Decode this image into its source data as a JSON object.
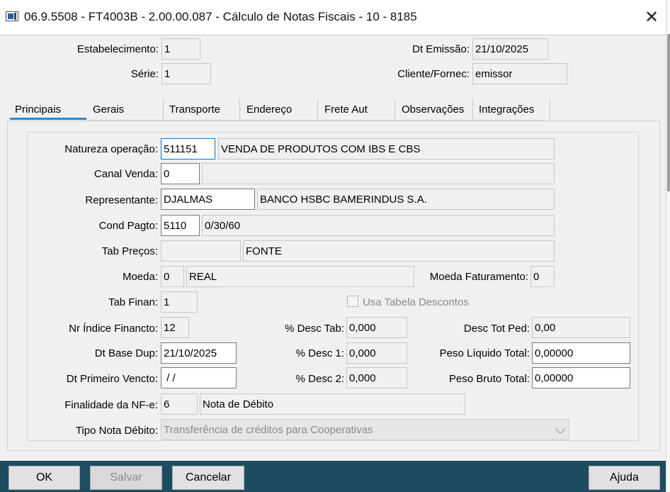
{
  "window": {
    "title": "06.9.5508 - FT4003B - 2.00.00.087 - Cálculo de Notas Fiscais - 10 - 8185",
    "close_icon": "close-icon"
  },
  "header": {
    "estabelecimento_label": "Estabelecimento:",
    "estabelecimento_value": "1",
    "serie_label": "Série:",
    "serie_value": "1",
    "dt_emissao_label": "Dt Emissão:",
    "dt_emissao_value": "21/10/2025",
    "cliente_label": "Cliente/Fornec:",
    "cliente_value": "emissor"
  },
  "tabs": [
    {
      "label": "Principais",
      "active": true
    },
    {
      "label": "Gerais"
    },
    {
      "label": "Transporte"
    },
    {
      "label": "Endereço"
    },
    {
      "label": "Frete Aut"
    },
    {
      "label": "Observações"
    },
    {
      "label": "Integrações"
    }
  ],
  "form": {
    "natureza_label": "Natureza operação:",
    "natureza_code": "511151",
    "natureza_desc": "VENDA DE PRODUTOS COM IBS E CBS",
    "canal_label": "Canal Venda:",
    "canal_code": "0",
    "canal_desc": "",
    "representante_label": "Representante:",
    "representante_code": "DJALMAS",
    "representante_desc": "BANCO HSBC BAMERINDUS S.A.",
    "cond_pagto_label": "Cond Pagto:",
    "cond_pagto_code": "5110",
    "cond_pagto_desc": "0/30/60",
    "tab_precos_label": "Tab Preços:",
    "tab_precos_code": "",
    "tab_precos_desc": "FONTE",
    "moeda_label": "Moeda:",
    "moeda_code": "0",
    "moeda_desc": "REAL",
    "moeda_fat_label": "Moeda Faturamento:",
    "moeda_fat_value": "0",
    "tab_finan_label": "Tab Finan:",
    "tab_finan_value": "1",
    "usa_tabela_label": "Usa Tabela Descontos",
    "usa_tabela_checked": false,
    "nr_indice_label": "Nr Índice Financto:",
    "nr_indice_value": "12",
    "desc_tab_label": "% Desc Tab:",
    "desc_tab_value": "0,000",
    "desc_tot_label": "Desc Tot Ped:",
    "desc_tot_value": "0,00",
    "dt_base_label": "Dt Base Dup:",
    "dt_base_value": "21/10/2025",
    "desc1_label": "% Desc 1:",
    "desc1_value": "0,000",
    "peso_liq_label": "Peso Líquido Total:",
    "peso_liq_value": "0,00000",
    "dt_primeiro_label": "Dt Primeiro Vencto:",
    "dt_primeiro_value": " / /",
    "desc2_label": "% Desc 2:",
    "desc2_value": "0,000",
    "peso_bruto_label": "Peso Bruto Total:",
    "peso_bruto_value": "0,00000",
    "finalidade_label": "Finalidade da NF-e:",
    "finalidade_code": "6",
    "finalidade_desc": "Nota de Débito",
    "tipo_nota_label": "Tipo Nota Débito:",
    "tipo_nota_value": "Transferência de créditos para Cooperativas"
  },
  "footer": {
    "ok_label": "OK",
    "salvar_label": "Salvar",
    "cancelar_label": "Cancelar",
    "ajuda_label": "Ajuda"
  },
  "colors": {
    "footer_bg": "#1d4d60",
    "tab_accent": "#1a8fd6",
    "focus_border": "#0078d7"
  }
}
